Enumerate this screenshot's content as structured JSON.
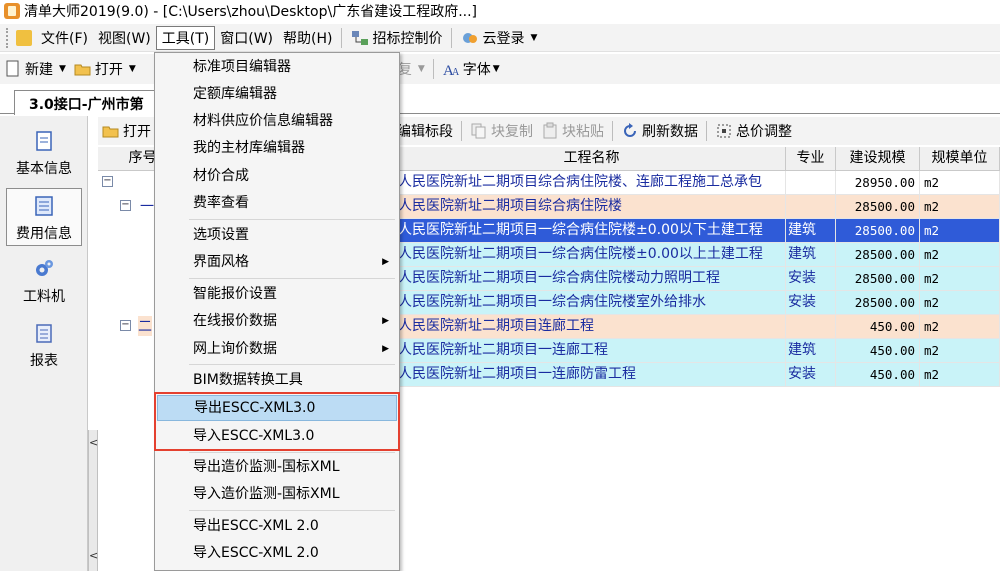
{
  "window": {
    "title": "清单大师2019(9.0) - [C:\\Users\\zhou\\Desktop\\广东省建设工程政府...]"
  },
  "menubar": {
    "items": [
      {
        "label": "文件(F)"
      },
      {
        "label": "视图(W)"
      },
      {
        "label": "工具(T)"
      },
      {
        "label": "窗口(W)"
      },
      {
        "label": "帮助(H)"
      },
      {
        "label": "招标控制价"
      },
      {
        "label": "云登录"
      }
    ]
  },
  "toolbar": {
    "new_label": "新建",
    "open_label": "打开",
    "restore_label": "恢复",
    "font_label": "字体"
  },
  "document_tab": {
    "label": "3.0接口-广州市第"
  },
  "leftnav": {
    "items": [
      {
        "label": "基本信息"
      },
      {
        "label": "费用信息"
      },
      {
        "label": "工料机"
      },
      {
        "label": "报表"
      }
    ],
    "collapse_glyph": "<"
  },
  "subbar": {
    "open_label": "打开",
    "edit_section_label": "编辑标段",
    "block_copy_label": "块复制",
    "block_paste_label": "块粘贴",
    "refresh_label": "刷新数据",
    "adjust_label": "总价调整"
  },
  "grid": {
    "headers": {
      "seq": "序号",
      "name": "工程名称",
      "spec": "专业",
      "scale": "建设规模",
      "unit": "规模单位"
    },
    "rows": [
      {
        "name": "人民医院新址二期项目综合病住院楼、连廊工程施工总承包",
        "spec": "",
        "scale": "28950.00",
        "unit": "m2"
      },
      {
        "name": "人民医院新址二期项目综合病住院楼",
        "spec": "",
        "scale": "28500.00",
        "unit": "m2"
      },
      {
        "name": "人民医院新址二期项目一综合病住院楼±0.00以下土建工程",
        "spec": "建筑",
        "scale": "28500.00",
        "unit": "m2"
      },
      {
        "name": "人民医院新址二期项目一综合病住院楼±0.00以上土建工程",
        "spec": "建筑",
        "scale": "28500.00",
        "unit": "m2"
      },
      {
        "name": "人民医院新址二期项目一综合病住院楼动力照明工程",
        "spec": "安装",
        "scale": "28500.00",
        "unit": "m2"
      },
      {
        "name": "人民医院新址二期项目一综合病住院楼室外给排水",
        "spec": "安装",
        "scale": "28500.00",
        "unit": "m2"
      },
      {
        "name": "人民医院新址二期项目连廊工程",
        "spec": "",
        "scale": "450.00",
        "unit": "m2"
      },
      {
        "name": "人民医院新址二期项目一连廊工程",
        "spec": "建筑",
        "scale": "450.00",
        "unit": "m2"
      },
      {
        "name": "人民医院新址二期项目一连廊防雷工程",
        "spec": "安装",
        "scale": "450.00",
        "unit": "m2"
      }
    ],
    "tree_glyphs": {
      "root": "−",
      "a": "一",
      "b": "二"
    }
  },
  "tools_menu": {
    "items": [
      {
        "label": "标准项目编辑器"
      },
      {
        "label": "定额库编辑器"
      },
      {
        "label": "材料供应价信息编辑器"
      },
      {
        "label": "我的主材库编辑器"
      },
      {
        "label": "材价合成"
      },
      {
        "label": "费率查看"
      },
      {
        "label": "选项设置"
      },
      {
        "label": "界面风格"
      },
      {
        "label": "智能报价设置"
      },
      {
        "label": "在线报价数据"
      },
      {
        "label": "网上询价数据"
      },
      {
        "label": "BIM数据转换工具"
      },
      {
        "label": "导出ESCC-XML3.0"
      },
      {
        "label": "导入ESCC-XML3.0"
      },
      {
        "label": "导出造价监测-国标XML"
      },
      {
        "label": "导入造价监测-国标XML"
      },
      {
        "label": "导出ESCC-XML 2.0"
      },
      {
        "label": "导入ESCC-XML 2.0"
      }
    ],
    "submenu_glyph": "▶"
  },
  "colors": {
    "selection": "#2f5bd8",
    "highlight": "#bcdcf4",
    "annotation": "#e4402f",
    "peach": "#fbe2cf",
    "cyan": "#c9f3f8"
  }
}
